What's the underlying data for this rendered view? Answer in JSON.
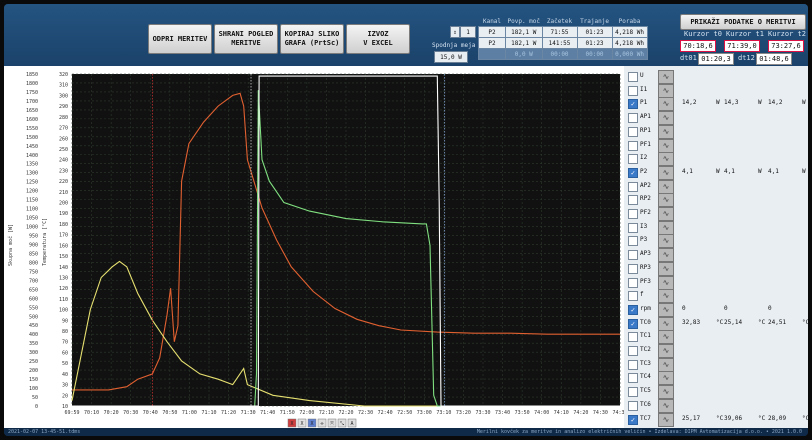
{
  "toolbar": {
    "buttons": [
      "ODPRI MERITEV",
      "SHRANI POGLED\nMERITVE",
      "KOPIRAJ SLIKO\nGRAFA (PrtSc)",
      "IZVOZ\nV EXCEL"
    ]
  },
  "spinner": {
    "value": "1"
  },
  "spodnja_meja": {
    "label": "Spodnja meja",
    "value": "15,0 W"
  },
  "measurements": {
    "headers": [
      "Kanal",
      "Povp. moč",
      "Začetek",
      "Trajanje",
      "Poraba"
    ],
    "rows": [
      [
        "P2",
        "182,1 W",
        "71:55",
        "01:23",
        "4,218 Wh"
      ],
      [
        "P2",
        "182,1 W",
        "141:55",
        "01:23",
        "4,218 Wh"
      ],
      [
        "",
        "0,0 W",
        "00:00",
        "00:00",
        "0,000 Wh"
      ]
    ]
  },
  "report_button": "PRIKAŽI PODATKE O MERITVI",
  "cursors": {
    "headers": [
      "Kurzor t0",
      "Kurzor t1",
      "Kurzor t2"
    ],
    "values": [
      "70:18,6",
      "71:39,0",
      "73:27,6"
    ],
    "dt_labels": [
      "dt01",
      "dt12"
    ],
    "dt_values": [
      "01:20,3",
      "01:48,6"
    ]
  },
  "chart_data": {
    "type": "line",
    "axes": {
      "power_left": {
        "label": "Skupna moč [W]",
        "ticks": [
          "1850",
          "1800",
          "1750",
          "1700",
          "1650",
          "1600",
          "1550",
          "1500",
          "1450",
          "1400",
          "1350",
          "1300",
          "1250",
          "1200",
          "1150",
          "1100",
          "1050",
          "1000",
          "950",
          "900",
          "850",
          "800",
          "750",
          "700",
          "650",
          "600",
          "550",
          "500",
          "450",
          "400",
          "350",
          "300",
          "250",
          "200",
          "150",
          "100",
          "50",
          "0"
        ],
        "range": [
          0,
          1850
        ]
      },
      "temperature": {
        "label": "Temperatura [°C]",
        "ticks": [
          "320",
          "310",
          "300",
          "290",
          "280",
          "270",
          "260",
          "250",
          "240",
          "230",
          "220",
          "210",
          "200",
          "190",
          "180",
          "170",
          "160",
          "150",
          "140",
          "130",
          "120",
          "110",
          "100",
          "90",
          "80",
          "70",
          "60",
          "50",
          "40",
          "30",
          "20",
          "10"
        ],
        "range": [
          10,
          320
        ]
      },
      "x": {
        "ticks": [
          "69:59",
          "70:10",
          "70:20",
          "70:30",
          "70:40",
          "70:50",
          "71:00",
          "71:10",
          "71:20",
          "71:30",
          "71:40",
          "71:50",
          "72:00",
          "72:10",
          "72:20",
          "72:30",
          "72:40",
          "72:50",
          "73:00",
          "73:10",
          "73:20",
          "73:30",
          "73:40",
          "73:50",
          "74:00",
          "74:10",
          "74:20",
          "74:30",
          "74:37"
        ]
      }
    },
    "series": [
      {
        "name": "TC0",
        "color": "#e06030",
        "points": [
          [
            0,
            25
          ],
          [
            10,
            25
          ],
          [
            15,
            28
          ],
          [
            18,
            35
          ],
          [
            22,
            40
          ],
          [
            24,
            55
          ],
          [
            26,
            95
          ],
          [
            27,
            120
          ],
          [
            28,
            70
          ],
          [
            29,
            85
          ],
          [
            30,
            220
          ],
          [
            32,
            255
          ],
          [
            36,
            275
          ],
          [
            40,
            290
          ],
          [
            44,
            300
          ],
          [
            46,
            302
          ],
          [
            47,
            290
          ],
          [
            48,
            240
          ],
          [
            52,
            195
          ],
          [
            56,
            165
          ],
          [
            60,
            140
          ],
          [
            66,
            117
          ],
          [
            72,
            101
          ],
          [
            78,
            91
          ],
          [
            84,
            85
          ],
          [
            90,
            81
          ],
          [
            100,
            79
          ],
          [
            110,
            78
          ],
          [
            120,
            78
          ],
          [
            130,
            77
          ],
          [
            140,
            77
          ],
          [
            150,
            77
          ]
        ]
      },
      {
        "name": "P1",
        "color": "#e6e070",
        "points": [
          [
            0,
            15
          ],
          [
            5,
            100
          ],
          [
            8,
            130
          ],
          [
            11,
            140
          ],
          [
            13,
            145
          ],
          [
            15,
            140
          ],
          [
            18,
            115
          ],
          [
            22,
            90
          ],
          [
            26,
            70
          ],
          [
            30,
            52
          ],
          [
            35,
            40
          ],
          [
            40,
            35
          ],
          [
            44,
            30
          ],
          [
            47,
            45
          ],
          [
            48,
            30
          ],
          [
            55,
            20
          ],
          [
            65,
            15
          ],
          [
            80,
            10
          ],
          [
            100,
            8
          ],
          [
            150,
            6
          ]
        ]
      },
      {
        "name": "P2",
        "color": "#80e080",
        "points": [
          [
            0,
            0
          ],
          [
            50,
            0
          ],
          [
            50.5,
            40
          ],
          [
            51,
            305
          ],
          [
            52,
            240
          ],
          [
            54,
            220
          ],
          [
            58,
            200
          ],
          [
            65,
            192
          ],
          [
            75,
            185
          ],
          [
            85,
            182
          ],
          [
            96,
            180
          ],
          [
            97,
            180
          ],
          [
            98,
            160
          ],
          [
            99,
            20
          ],
          [
            100,
            0
          ],
          [
            150,
            0
          ]
        ]
      },
      {
        "name": "U",
        "color": "#ffffff",
        "points": [
          [
            0,
            0
          ],
          [
            50,
            0
          ],
          [
            51,
            0
          ],
          [
            51.2,
            318
          ],
          [
            100,
            318
          ],
          [
            100.5,
            200
          ],
          [
            101,
            0
          ],
          [
            150,
            0
          ]
        ]
      }
    ],
    "cursors_x": [
      22,
      49,
      102
    ],
    "grid": true
  },
  "channels": [
    {
      "name": "U",
      "checked": false,
      "values": []
    },
    {
      "name": "I1",
      "checked": false,
      "values": []
    },
    {
      "name": "P1",
      "checked": true,
      "values": [
        "14,2",
        "W",
        "14,3",
        "W",
        "14,2",
        "W"
      ]
    },
    {
      "name": "AP1",
      "checked": false,
      "values": []
    },
    {
      "name": "RP1",
      "checked": false,
      "values": []
    },
    {
      "name": "PF1",
      "checked": false,
      "values": []
    },
    {
      "name": "I2",
      "checked": false,
      "values": []
    },
    {
      "name": "P2",
      "checked": true,
      "values": [
        "4,1",
        "W",
        "4,1",
        "W",
        "4,1",
        "W"
      ]
    },
    {
      "name": "AP2",
      "checked": false,
      "values": []
    },
    {
      "name": "RP2",
      "checked": false,
      "values": []
    },
    {
      "name": "PF2",
      "checked": false,
      "values": []
    },
    {
      "name": "I3",
      "checked": false,
      "values": []
    },
    {
      "name": "P3",
      "checked": false,
      "values": []
    },
    {
      "name": "AP3",
      "checked": false,
      "values": []
    },
    {
      "name": "RP3",
      "checked": false,
      "values": []
    },
    {
      "name": "PF3",
      "checked": false,
      "values": []
    },
    {
      "name": "f",
      "checked": false,
      "values": []
    },
    {
      "name": "rpm",
      "checked": true,
      "values": [
        "0",
        "",
        "0",
        "",
        "0",
        ""
      ]
    },
    {
      "name": "TC0",
      "checked": true,
      "values": [
        "32,83",
        "°C",
        "25,14",
        "°C",
        "24,51",
        "°C"
      ]
    },
    {
      "name": "TC1",
      "checked": false,
      "values": []
    },
    {
      "name": "TC2",
      "checked": false,
      "values": []
    },
    {
      "name": "TC3",
      "checked": false,
      "values": []
    },
    {
      "name": "TC4",
      "checked": false,
      "values": []
    },
    {
      "name": "TC5",
      "checked": false,
      "values": []
    },
    {
      "name": "TC6",
      "checked": false,
      "values": []
    },
    {
      "name": "TC7",
      "checked": true,
      "values": [
        "25,17",
        "°C",
        "39,06",
        "°C",
        "28,09",
        "°C"
      ]
    }
  ],
  "status": {
    "left": "2021-02-07 13-45-51.tdms",
    "right": "Merilni kovček za meritve in analizo električnih veličin • Izdelava: DIPM Avtomatizacija d.o.o. • 2021 1.0.0"
  }
}
